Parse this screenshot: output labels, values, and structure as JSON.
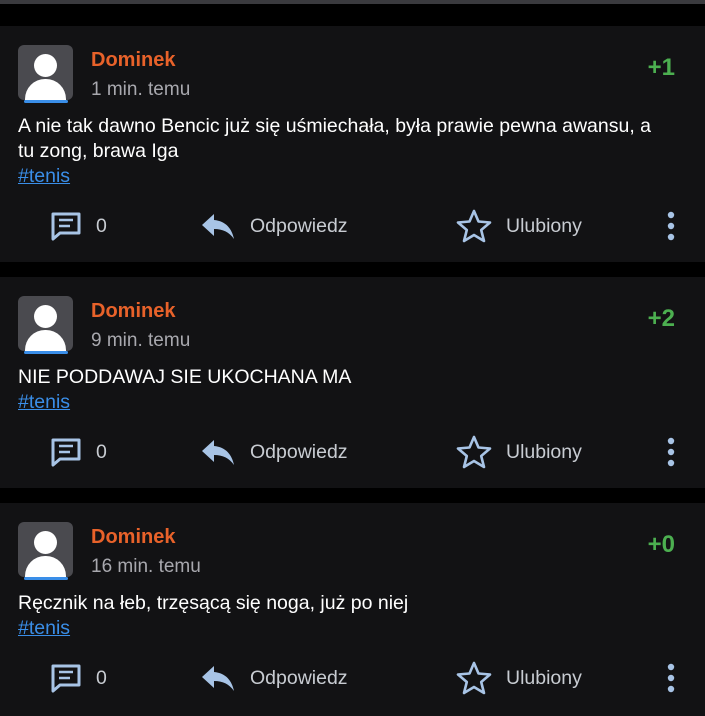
{
  "posts": [
    {
      "author": "Dominek",
      "time": "1 min. temu",
      "score": "+1",
      "text": "A nie tak dawno Bencic już się uśmiechała, była prawie pewna awansu, a tu zong, brawa Iga",
      "tag": "#tenis",
      "comments": "0",
      "reply_label": "Odpowiedz",
      "fav_label": "Ulubiony"
    },
    {
      "author": "Dominek",
      "time": "9 min. temu",
      "score": "+2",
      "text": "NIE PODDAWAJ SIE UKOCHANA MA",
      "tag": "#tenis",
      "comments": "0",
      "reply_label": "Odpowiedz",
      "fav_label": "Ulubiony"
    },
    {
      "author": "Dominek",
      "time": "16 min. temu",
      "score": "+0",
      "text": "Ręcznik na łeb, trzęsącą się noga, już po niej",
      "tag": "#tenis",
      "comments": "0",
      "reply_label": "Odpowiedz",
      "fav_label": "Ulubiony"
    }
  ],
  "colors": {
    "author": "#e8622a",
    "score": "#4caf50",
    "tag": "#3a8ee8",
    "icon": "#a8c4e6"
  },
  "icons": [
    "avatar-icon",
    "comment-icon",
    "reply-icon",
    "star-icon",
    "more-vertical-icon"
  ]
}
